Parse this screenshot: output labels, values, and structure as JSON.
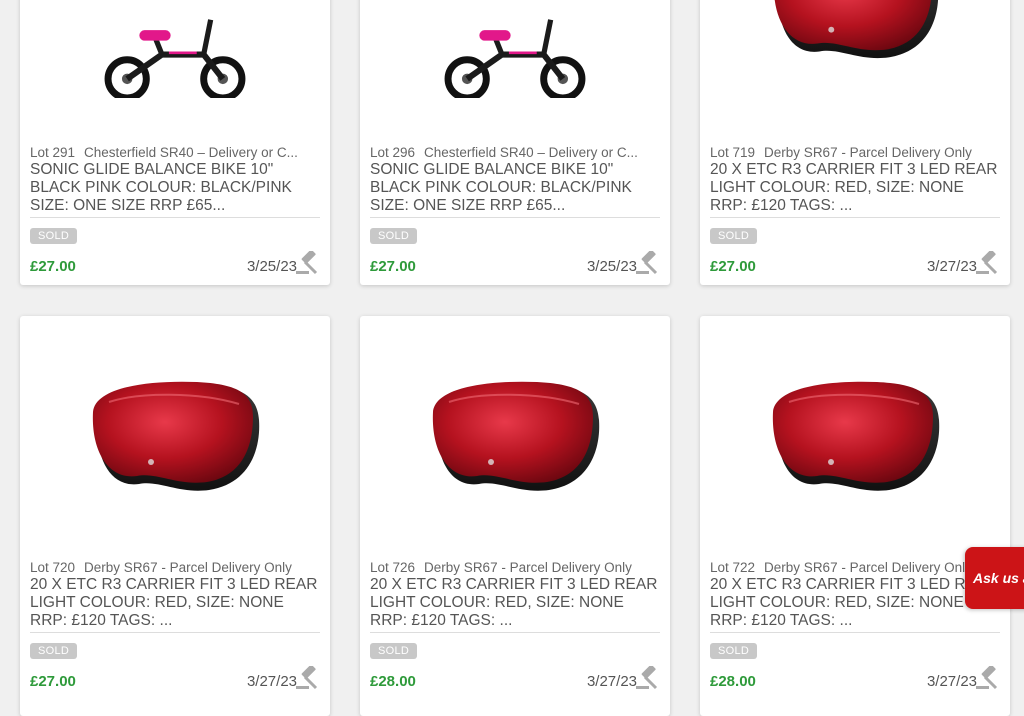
{
  "lots": [
    {
      "lot_no": "Lot 291",
      "location": "Chesterfield SR40 – Delivery or C...",
      "title": "SONIC GLIDE BALANCE BIKE 10\" BLACK PINK COLOUR: BLACK/PINK SIZE: ONE SIZE RRP £65...",
      "status": "SOLD",
      "price": "£27.00",
      "date": "3/25/23",
      "image": "balance-bike"
    },
    {
      "lot_no": "Lot 296",
      "location": "Chesterfield SR40 – Delivery or C...",
      "title": "SONIC GLIDE BALANCE BIKE 10\" BLACK PINK COLOUR: BLACK/PINK SIZE: ONE SIZE RRP £65...",
      "status": "SOLD",
      "price": "£27.00",
      "date": "3/25/23",
      "image": "balance-bike"
    },
    {
      "lot_no": "Lot 719",
      "location": "Derby SR67 - Parcel Delivery Only",
      "title": "20 X ETC R3 CARRIER FIT 3 LED REAR LIGHT COLOUR: RED, SIZE: NONE RRP: £120 TAGS: ...",
      "status": "SOLD",
      "price": "£27.00",
      "date": "3/27/23",
      "image": "rear-light"
    },
    {
      "lot_no": "Lot 720",
      "location": "Derby SR67 - Parcel Delivery Only",
      "title": "20 X ETC R3 CARRIER FIT 3 LED REAR LIGHT COLOUR: RED, SIZE: NONE RRP: £120 TAGS: ...",
      "status": "SOLD",
      "price": "£27.00",
      "date": "3/27/23",
      "image": "rear-light"
    },
    {
      "lot_no": "Lot 726",
      "location": "Derby SR67 - Parcel Delivery Only",
      "title": "20 X ETC R3 CARRIER FIT 3 LED REAR LIGHT COLOUR: RED, SIZE: NONE RRP: £120 TAGS: ...",
      "status": "SOLD",
      "price": "£28.00",
      "date": "3/27/23",
      "image": "rear-light"
    },
    {
      "lot_no": "Lot 722",
      "location": "Derby SR67 - Parcel Delivery Only",
      "title": "20 X ETC R3 CARRIER FIT 3 LED REAR LIGHT COLOUR: RED, SIZE: NONE RRP: £120 TAGS: ...",
      "status": "SOLD",
      "price": "£28.00",
      "date": "3/27/23",
      "image": "rear-light"
    }
  ],
  "chat_tab": {
    "label": "Ask us a"
  },
  "colors": {
    "price": "#2e9a3a",
    "sold_badge": "#c8c8c8",
    "chat_tab": "#cc1417",
    "background": "#f0f0f0"
  },
  "icons": {
    "bid": "gavel-icon"
  }
}
